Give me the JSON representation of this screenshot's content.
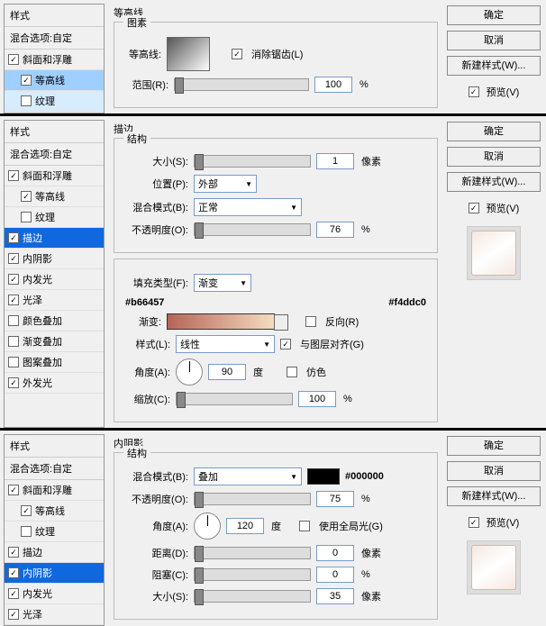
{
  "common": {
    "sidebar_title": "样式",
    "blend_opt": "混合选项:自定",
    "ok": "确定",
    "cancel": "取消",
    "new_style": "新建样式(W)...",
    "preview": "预览(V)",
    "items": {
      "bevel": "斜面和浮雕",
      "contour": "等高线",
      "texture": "纹理",
      "stroke": "描边",
      "inner_shadow": "内阴影",
      "inner_glow": "内发光",
      "satin": "光泽",
      "color_overlay": "颜色叠加",
      "grad_overlay": "渐变叠加",
      "pattern_overlay": "图案叠加",
      "outer_glow": "外发光"
    }
  },
  "p1": {
    "title": "等高线",
    "group": "图素",
    "contour_label": "等高线:",
    "antialias": "消除锯齿(L)",
    "range_label": "范围(R):",
    "range_val": "100",
    "pct": "%"
  },
  "p2": {
    "title": "描边",
    "group1": "结构",
    "size_label": "大小(S):",
    "size_val": "1",
    "px": "像素",
    "pos_label": "位置(P):",
    "pos_val": "外部",
    "blend_label": "混合模式(B):",
    "blend_val": "正常",
    "opacity_label": "不透明度(O):",
    "opacity_val": "76",
    "pct": "%",
    "fill_label": "填充类型(F):",
    "fill_val": "渐变",
    "hex1": "#b66457",
    "hex2": "#f4ddc0",
    "grad_label": "渐变:",
    "reverse": "反向(R)",
    "style_label": "样式(L):",
    "style_val": "线性",
    "align": "与图层对齐(G)",
    "angle_label": "角度(A):",
    "angle_val": "90",
    "deg": "度",
    "dither": "仿色",
    "scale_label": "缩放(C):",
    "scale_val": "100"
  },
  "p3": {
    "title": "内阴影",
    "group": "结构",
    "blend_label": "混合模式(B):",
    "blend_val": "叠加",
    "hex": "#000000",
    "opacity_label": "不透明度(O):",
    "opacity_val": "75",
    "pct": "%",
    "angle_label": "角度(A):",
    "angle_val": "120",
    "deg": "度",
    "global": "使用全局光(G)",
    "dist_label": "距离(D):",
    "dist_val": "0",
    "px": "像素",
    "choke_label": "阻塞(C):",
    "choke_val": "0",
    "size_label": "大小(S):",
    "size_val": "35"
  }
}
